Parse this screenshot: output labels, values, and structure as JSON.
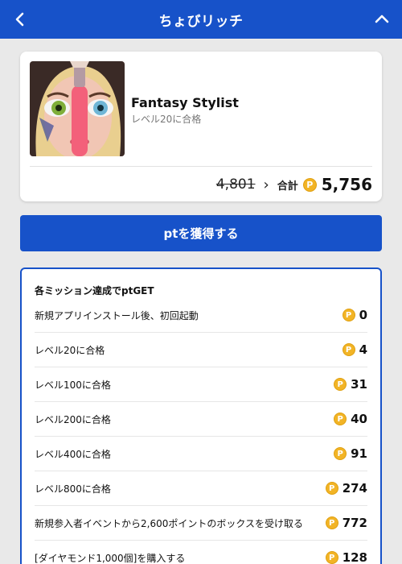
{
  "header": {
    "title": "ちょびリッチ"
  },
  "app": {
    "name": "Fantasy Stylist",
    "subtitle": "レベル20に合格",
    "old_points": "4,801",
    "arrow": "›",
    "total_label": "合計",
    "total_points": "5,756"
  },
  "coin_symbol": "P",
  "cta": {
    "label": "ptを獲得する"
  },
  "missions": {
    "title": "各ミッション達成でptGET",
    "items": [
      {
        "label": "新規アプリインストール後、初回起動",
        "points": "0"
      },
      {
        "label": "レベル20に合格",
        "points": "4"
      },
      {
        "label": "レベル100に合格",
        "points": "31"
      },
      {
        "label": "レベル200に合格",
        "points": "40"
      },
      {
        "label": "レベル400に合格",
        "points": "91"
      },
      {
        "label": "レベル800に合格",
        "points": "274"
      },
      {
        "label": "新規参入者イベントから2,600ポイントのボックスを受け取る",
        "points": "772"
      },
      {
        "label": "[ダイヤモンド1,000個]を購入する",
        "points": "128"
      }
    ]
  },
  "colors": {
    "brand": "#1752c9",
    "coin": "#f2b426"
  },
  "icons": {
    "back": "chevron-left-icon",
    "collapse": "chevron-up-icon",
    "coin": "coin-icon"
  }
}
